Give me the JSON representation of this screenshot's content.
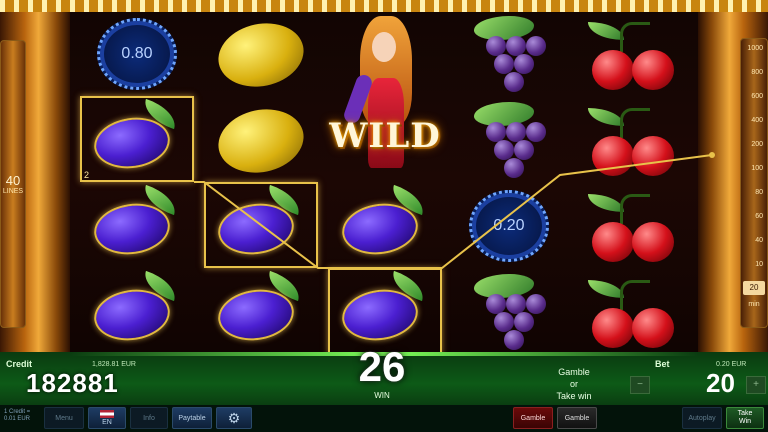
{
  "lines": {
    "count": "40",
    "label": "LINES"
  },
  "reels": {
    "coin1": "0.80",
    "coin2": "0.20",
    "wild": "WILD",
    "win_symbol_count": "2"
  },
  "bet_scale": {
    "ticks": [
      "1000",
      "800",
      "600",
      "400",
      "200",
      "100",
      "80",
      "60",
      "40",
      "20",
      "10"
    ],
    "selected": "20",
    "min_label": "min"
  },
  "credit": {
    "label": "Credit",
    "value": "182881",
    "eur": "1,828.81 EUR"
  },
  "win": {
    "value": "26",
    "label": "WIN"
  },
  "gamble_prompt": {
    "line1": "Gamble",
    "line2": "or",
    "line3": "Take win"
  },
  "bet": {
    "label": "Bet",
    "value": "20",
    "eur": "0.20 EUR",
    "minus": "−",
    "plus": "+"
  },
  "toolbar": {
    "credit_info_line1": "1 Credit =",
    "credit_info_line2": "0.01 EUR",
    "menu": "Menu",
    "lang": "EN",
    "info": "Info",
    "paytable": "Paytable",
    "gamble_red": "Gamble",
    "gamble_black": "Gamble",
    "autoplay": "Autoplay",
    "take_win_1": "Take",
    "take_win_2": "Win"
  },
  "colors": {
    "frame": "#e8c24a",
    "payline": "#e8c24a",
    "bottom_bar": "#0d5a17",
    "plum": "#4b1fd1"
  }
}
